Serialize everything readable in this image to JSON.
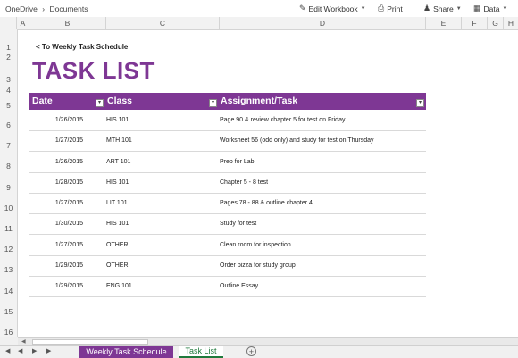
{
  "breadcrumb": {
    "root": "OneDrive",
    "sep": "›",
    "folder": "Documents"
  },
  "toolbar": {
    "edit": "Edit Workbook",
    "print": "Print",
    "share": "Share",
    "data": "Data"
  },
  "columns": [
    "A",
    "B",
    "C",
    "D",
    "E",
    "F",
    "G",
    "H"
  ],
  "rows": [
    "1",
    "2",
    "3",
    "4",
    "5",
    "6",
    "7",
    "8",
    "9",
    "10",
    "11",
    "12",
    "13",
    "14",
    "15",
    "16"
  ],
  "back_link": "< To Weekly Task Schedule",
  "title": "TASK LIST",
  "table": {
    "headers": {
      "date": "Date",
      "class": "Class",
      "assignment": "Assignment/Task"
    },
    "rows": [
      {
        "date": "1/26/2015",
        "class": "HIS 101",
        "assignment": "Page 90 & review chapter 5 for test on Friday"
      },
      {
        "date": "1/27/2015",
        "class": "MTH 101",
        "assignment": "Worksheet 56 (odd only) and study for test on Thursday"
      },
      {
        "date": "1/26/2015",
        "class": "ART 101",
        "assignment": "Prep for Lab"
      },
      {
        "date": "1/28/2015",
        "class": "HIS 101",
        "assignment": "Chapter 5 - 8 test"
      },
      {
        "date": "1/27/2015",
        "class": "LIT 101",
        "assignment": "Pages 78 - 88 & outline chapter 4"
      },
      {
        "date": "1/30/2015",
        "class": "HIS 101",
        "assignment": "Study for test"
      },
      {
        "date": "1/27/2015",
        "class": "OTHER",
        "assignment": "Clean room for inspection"
      },
      {
        "date": "1/29/2015",
        "class": "OTHER",
        "assignment": "Order pizza for study group"
      },
      {
        "date": "1/29/2015",
        "class": "ENG 101",
        "assignment": "Outline Essay"
      }
    ]
  },
  "sheets": {
    "tab1": "Weekly Task Schedule",
    "tab2": "Task List",
    "add": "+"
  },
  "colors": {
    "accent": "#7e3794",
    "active_tab": "#1e7a3c"
  }
}
